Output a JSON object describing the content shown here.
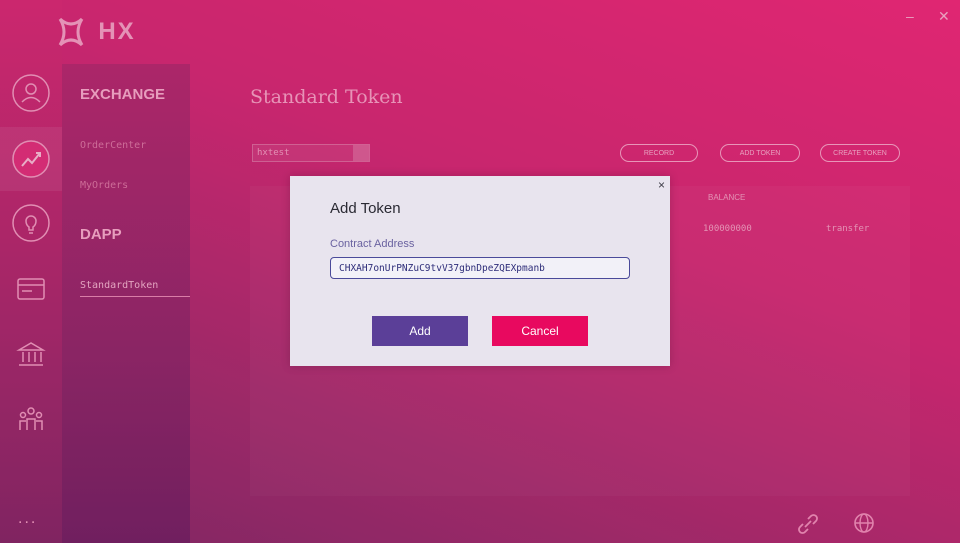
{
  "app": {
    "logo_text": "HX"
  },
  "sidebar": {
    "rail_icons": [
      "user-icon",
      "exchange-chart-icon",
      "lightbulb-icon",
      "card-icon",
      "bank-icon",
      "community-icon"
    ],
    "more": "..."
  },
  "submenu": {
    "exchange_title": "EXCHANGE",
    "exchange_items": [
      "OrderCenter",
      "MyOrders"
    ],
    "dapp_title": "DAPP",
    "dapp_items": [
      "StandardToken"
    ]
  },
  "window": {
    "minimize": "–",
    "close": "✕"
  },
  "page": {
    "title": "Standard Token",
    "account_select": "hxtest",
    "buttons": {
      "record": "RECORD",
      "add_token": "ADD TOKEN",
      "create_token": "CREATE TOKEN"
    },
    "table": {
      "balance_header": "BALANCE",
      "rows": [
        {
          "balance": "100000000",
          "action": "transfer"
        }
      ]
    }
  },
  "footer": {
    "link_icon": "link-icon",
    "globe_icon": "globe-icon"
  },
  "modal": {
    "title": "Add Token",
    "close_glyph": "×",
    "field_label": "Contract Address",
    "field_value": "CHXAH7onUrPNZuC9tvV37gbnDpeZQEXpmanb",
    "add_label": "Add",
    "cancel_label": "Cancel"
  },
  "colors": {
    "accent_purple": "#5b3f98",
    "accent_pink": "#e8095f",
    "modal_bg": "#e8e4ee"
  }
}
